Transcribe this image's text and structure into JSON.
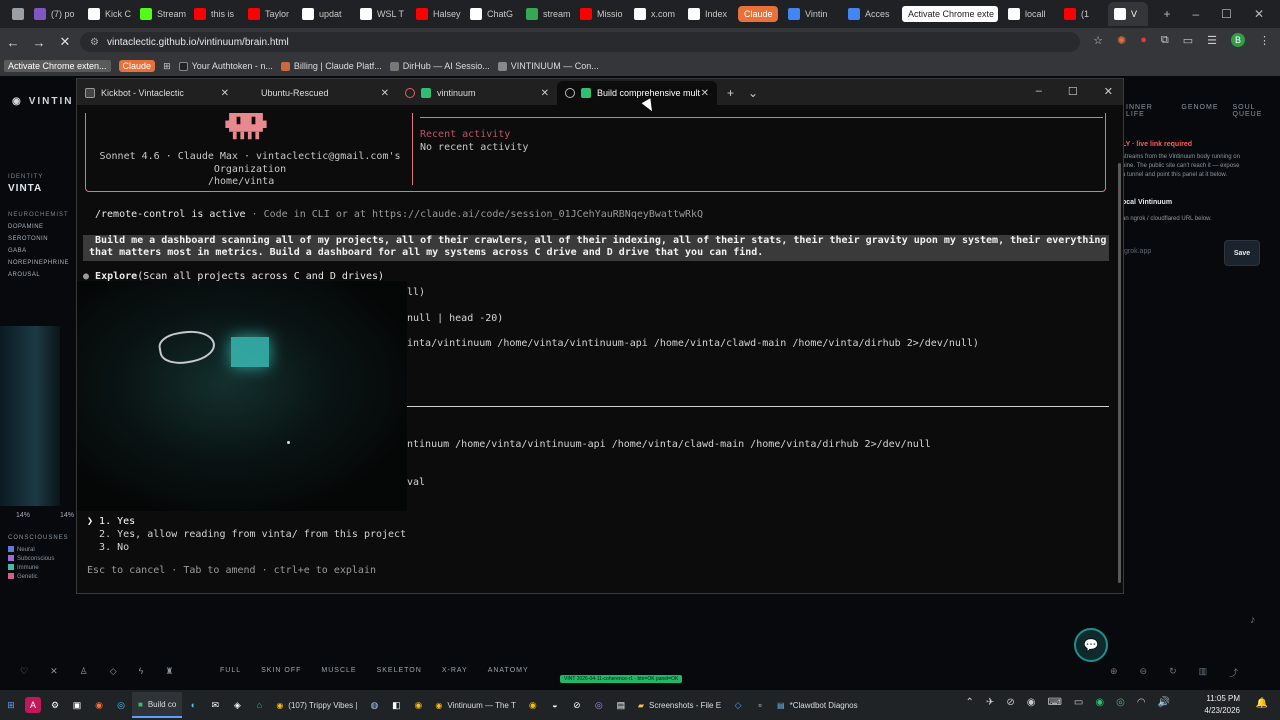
{
  "chrome": {
    "tabs": [
      {
        "label": "",
        "color": "#9aa0a6"
      },
      {
        "label": "(7) po",
        "color": "#7e57c2"
      },
      {
        "label": "Kick C",
        "color": "#ffffff"
      },
      {
        "label": "Stream",
        "color": "#53fc18"
      },
      {
        "label": "this is",
        "color": "#ff0000"
      },
      {
        "label": "Taylor",
        "color": "#ff0000"
      },
      {
        "label": "updat",
        "color": "#ffffff"
      },
      {
        "label": "WSL T",
        "color": "#ffffff"
      },
      {
        "label": "Halsey",
        "color": "#ff0000"
      },
      {
        "label": "ChatG",
        "color": "#ffffff"
      },
      {
        "label": "stream",
        "color": "#34a853"
      },
      {
        "label": "Missio",
        "color": "#ff0000"
      },
      {
        "label": "x.com",
        "color": "#ffffff"
      },
      {
        "label": "Index",
        "color": "#ffffff"
      },
      {
        "label": "Claude",
        "color": "#e8713a"
      },
      {
        "label": "Vintin",
        "color": "#4285f4"
      },
      {
        "label": "Acces",
        "color": "#4285f4"
      },
      {
        "label": "Activate Chrome exte",
        "color": "#ffffff"
      },
      {
        "label": "locall",
        "color": "#ffffff"
      },
      {
        "label": "(1",
        "color": "#ff0000"
      },
      {
        "label": "V",
        "color": "#ffffff"
      }
    ],
    "url": "vintaclectic.github.io/vintinuum/brain.html",
    "bookmarks": {
      "activate": "Activate Chrome exten...",
      "claude": "Claude",
      "items": [
        "Your Authtoken - n...",
        "Billing | Claude Platf...",
        "DirHub — AI Sessio...",
        "VINTINUUM — Con..."
      ]
    },
    "profile": "B"
  },
  "site": {
    "logo": "VINTIN",
    "identity_label": "IDENTITY",
    "identity_name": "VINTA",
    "neurochem_label": "NEUROCHEMIST",
    "neurochem": [
      "DOPAMINE",
      "SEROTONIN",
      "GABA",
      "NOREPINEPHRINE",
      "AROUSAL"
    ],
    "pct_left": "14%",
    "pct_right": "14%",
    "conscious_label": "CONSCIOUSNES",
    "conscious_legend": [
      {
        "label": "Neural",
        "color": "#5d7bd6"
      },
      {
        "label": "Subconscious",
        "color": "#a06ad6"
      },
      {
        "label": "Immune",
        "color": "#3fbfa6"
      },
      {
        "label": "Genetic",
        "color": "#d65d8f"
      }
    ],
    "right_tabs": [
      "INNER LIFE",
      "GENOME",
      "SOUL QUEUE"
    ],
    "right_warn": "LY · live link required",
    "right_text_1": "streams from the Vintinuum body running on",
    "right_text_2": "hine. The public site can't reach it — expose",
    "right_text_3": "a tunnel and point this panel at it below.",
    "local_title": "ocal Vintinuum",
    "local_text": "an ngrok / cloudflared URL below.",
    "ngrok_placeholder": "grok.app",
    "save": "Save",
    "modes": [
      "FULL",
      "SKIN OFF",
      "MUSCLE",
      "SKELETON",
      "X-RAY",
      "ANATOMY"
    ],
    "badge": "VINT 2026-04-11-coherence-r1 · btn=OK panel=OK"
  },
  "terminal": {
    "tabs": [
      {
        "label": "Kickbot - Vintaclectic"
      },
      {
        "label": "Ubuntu-Rescued"
      },
      {
        "label": "vintinuum"
      },
      {
        "label": "Build comprehensive mult"
      }
    ],
    "model_line": "Sonnet 4.6 · Claude Max · vintaclectic@gmail.com's Organization",
    "cwd": "/home/vinta",
    "recent_heading": "Recent activity",
    "recent_value": "No recent activity",
    "rc_active": "/remote-control is active",
    "rc_rest": " · Code in CLI or at https://claude.ai/code/session_01JCehYauRBNqeyBwattwRkQ",
    "prompt_1": "Build me a dashboard scanning all of my projects, all of their crawlers, all of their indexing, all of their stats, their their gravity upon my system, their everything",
    "prompt_2": "that matters most in metrics. Build a dashboard for all my systems across C drive and D drive that you can find.",
    "explore_title": "Explore",
    "explore_args": "(Scan all projects across C and D drives)",
    "line_a": "ll)",
    "line_b": "null | head -20)",
    "line_c": "inta/vintinuum /home/vinta/vintinuum-api /home/vinta/clawd-main /home/vinta/dirhub 2>/dev/null)",
    "line_d": "ntinuum /home/vinta/vintinuum-api /home/vinta/clawd-main /home/vinta/dirhub 2>/dev/null",
    "line_e": "val",
    "options": [
      "1. Yes",
      "2. Yes, allow reading from vinta/ from this project",
      "3. No"
    ],
    "footer": "Esc to cancel · Tab to amend · ctrl+e to explain"
  },
  "taskbar": {
    "items": [
      "Build co",
      "(107) Trippy Vibes |",
      "Vintinuum — The T",
      "Screenshots - File E",
      "*Clawdbot Diagnos"
    ],
    "time": "11:05 PM",
    "date": "4/23/2026"
  }
}
